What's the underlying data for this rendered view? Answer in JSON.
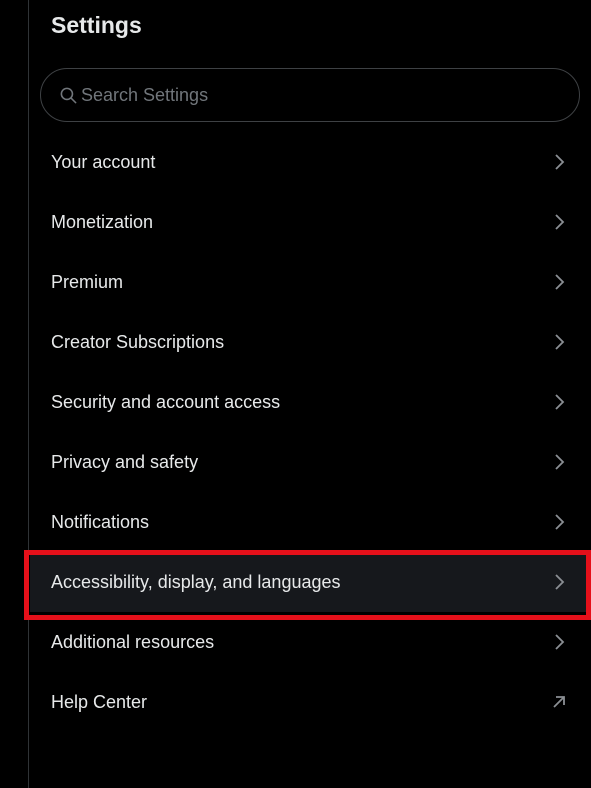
{
  "settings": {
    "title": "Settings"
  },
  "search": {
    "placeholder": "Search Settings",
    "value": ""
  },
  "menu": {
    "items": [
      {
        "label": "Your account",
        "icon": "chevron-right-icon"
      },
      {
        "label": "Monetization",
        "icon": "chevron-right-icon"
      },
      {
        "label": "Premium",
        "icon": "chevron-right-icon"
      },
      {
        "label": "Creator Subscriptions",
        "icon": "chevron-right-icon"
      },
      {
        "label": "Security and account access",
        "icon": "chevron-right-icon"
      },
      {
        "label": "Privacy and safety",
        "icon": "chevron-right-icon"
      },
      {
        "label": "Notifications",
        "icon": "chevron-right-icon"
      },
      {
        "label": "Accessibility, display, and languages",
        "icon": "chevron-right-icon",
        "selected": true
      },
      {
        "label": "Additional resources",
        "icon": "chevron-right-icon"
      },
      {
        "label": "Help Center",
        "icon": "external-link-arrow-icon"
      }
    ]
  },
  "colors": {
    "background": "#000000",
    "text": "#e7e9ea",
    "muted": "#71767b",
    "selected_row": "#16181c",
    "highlight": "#e5101a"
  }
}
